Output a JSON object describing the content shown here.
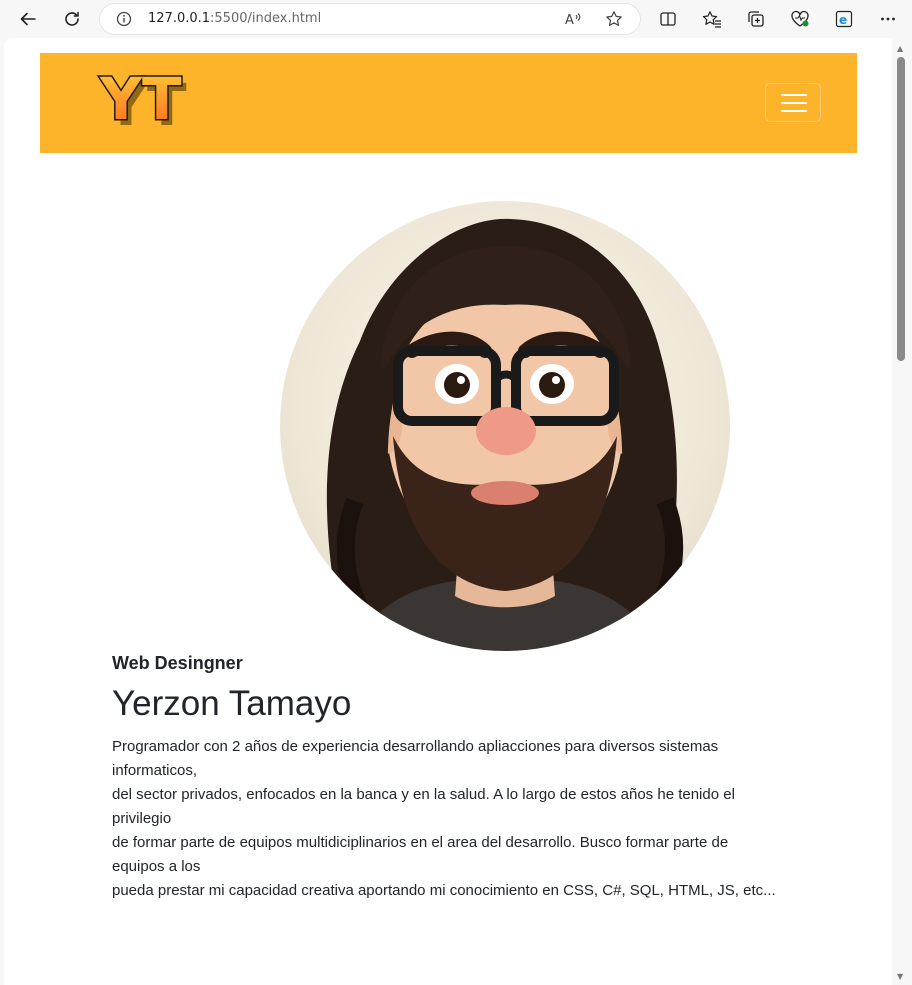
{
  "browser": {
    "url_host": "127.0.0.1",
    "url_rest": ":5500/index.html",
    "icons": [
      "back-icon",
      "refresh-icon",
      "info-icon",
      "read-aloud-icon",
      "favorite-star-icon",
      "split-screen-icon",
      "favorites-icon",
      "collections-icon",
      "browser-health-icon",
      "internet-explorer-mode-icon",
      "more-icon"
    ]
  },
  "navbar": {
    "background": "#fdb32a",
    "logo_text": "YT"
  },
  "profile": {
    "role": "Web Desingner",
    "name": "Yerzon Tamayo",
    "bio_lines": [
      "Programador con 2 años de experiencia desarrollando apliacciones para diversos sistemas informaticos,",
      "del sector privados, enfocados en la banca y en la salud. A lo largo de estos años he tenido el privilegio",
      "de formar parte de equipos multidiciplinarios en el area del desarrollo. Busco formar parte de equipos a los",
      "pueda prestar mi capacidad creativa aportando mi conocimiento en CSS, C#, SQL, HTML, JS, etc..."
    ]
  }
}
